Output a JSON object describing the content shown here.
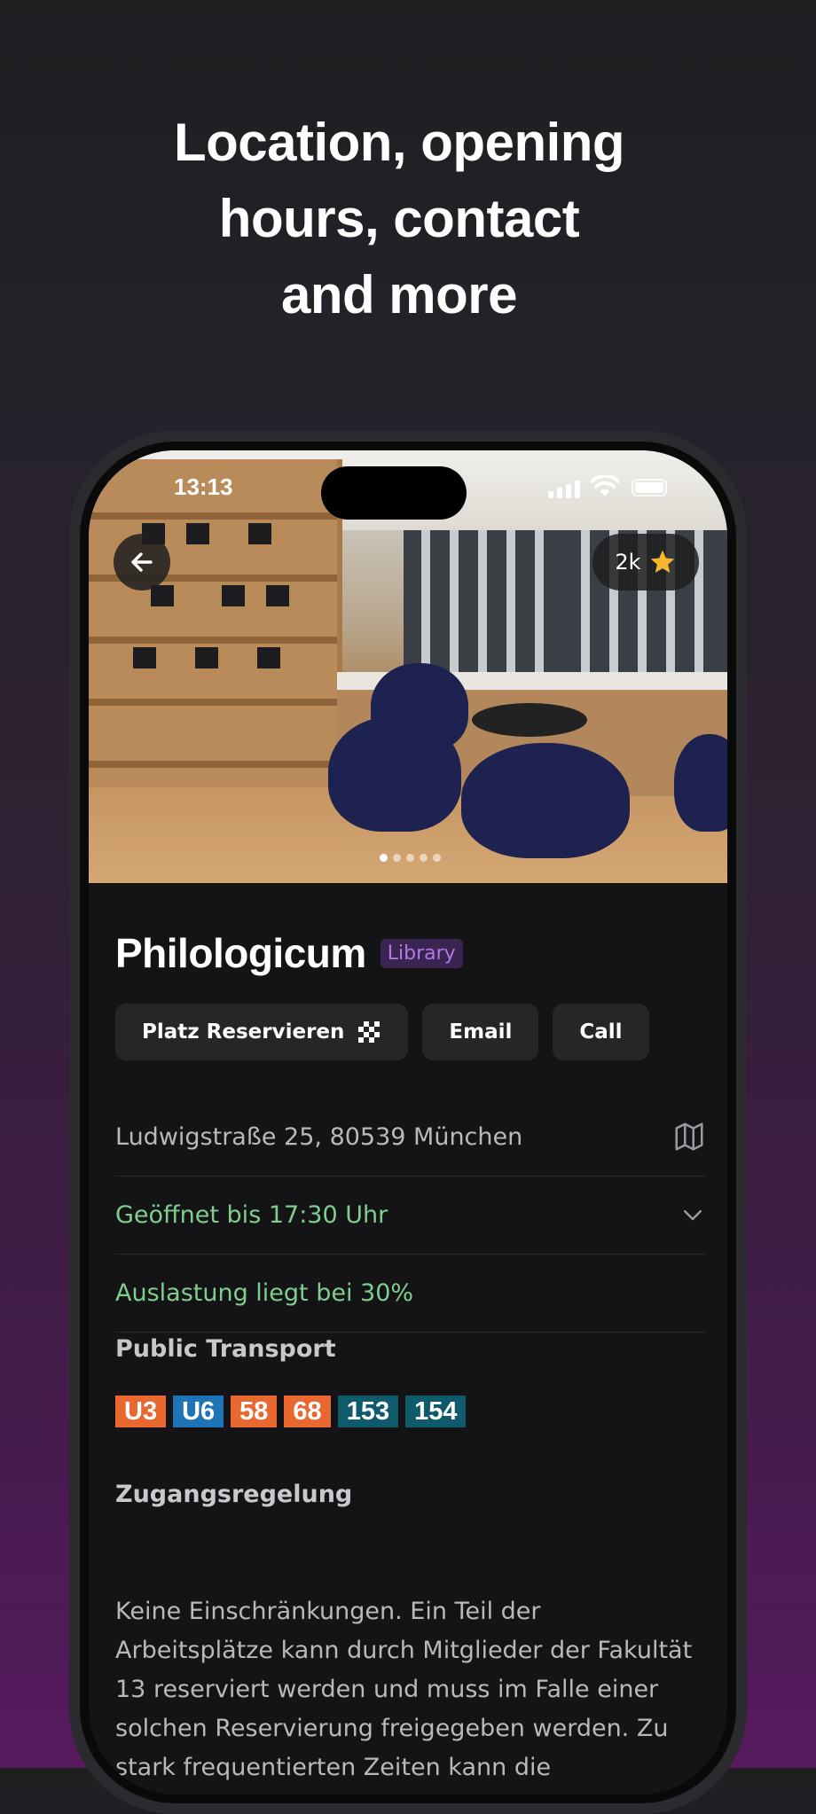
{
  "headline": [
    "Location, opening",
    "hours, contact",
    "and more"
  ],
  "status": {
    "time": "13:13"
  },
  "hero": {
    "rating": "2k",
    "rating_icon": "star-icon",
    "photo_count": 5,
    "active_photo": 1
  },
  "place": {
    "name": "Philologicum",
    "category": "Library"
  },
  "actions": {
    "reserve": "Platz Reservieren",
    "email": "Email",
    "call": "Call"
  },
  "info": {
    "address": "Ludwigstraße 25, 80539 München",
    "opening": "Geöffnet bis 17:30 Uhr",
    "occupancy": "Auslastung liegt bei 30%"
  },
  "transport": {
    "title": "Public Transport",
    "lines": [
      {
        "label": "U3",
        "color": "#e8682f"
      },
      {
        "label": "U6",
        "color": "#1f74b8"
      },
      {
        "label": "58",
        "color": "#e8682f"
      },
      {
        "label": "68",
        "color": "#e8682f"
      },
      {
        "label": "153",
        "color": "#0f5b6b"
      },
      {
        "label": "154",
        "color": "#0f5b6b"
      }
    ]
  },
  "access": {
    "title": "Zugangsregelung",
    "text": "Keine Einschränkungen. Ein Teil der Arbeitsplätze kann durch Mitglieder der Fakultät 13 reserviert werden und muss im Falle einer solchen Reservierung freigegeben werden. Zu stark frequentierten Zeiten kann die"
  },
  "colors": {
    "accent": "#b078e8",
    "open": "#7fce8e"
  }
}
